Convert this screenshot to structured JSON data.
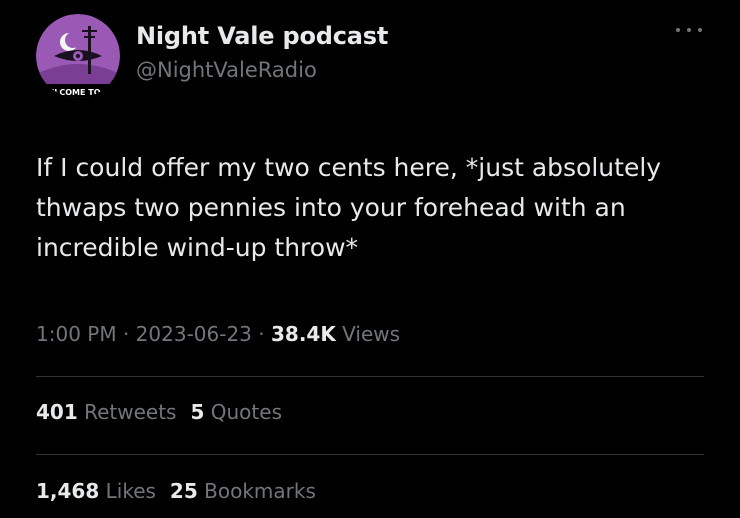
{
  "author": {
    "name": "Night Vale podcast",
    "handle": "@NightValeRadio",
    "avatar_text": "WELCOME TO NIGHT VALE",
    "avatar_colors": {
      "bg": "#9b59b6",
      "ring": "#2b1b33",
      "ink": "#1a1020"
    }
  },
  "tweet": {
    "text": "If I could offer my two cents here, *just absolutely thwaps two pennies into your forehead with an incredible wind-up throw*"
  },
  "meta": {
    "time": "1:00 PM",
    "sep1": " · ",
    "date": "2023-06-23",
    "sep2": " · ",
    "views_count": "38.4K",
    "views_label": " Views"
  },
  "stats_row1": {
    "retweets_count": "401",
    "retweets_label": " Retweets",
    "quotes_count": "5",
    "quotes_label": " Quotes"
  },
  "stats_row2": {
    "likes_count": "1,468",
    "likes_label": " Likes",
    "bookmarks_count": "25",
    "bookmarks_label": " Bookmarks"
  },
  "colors": {
    "background": "#000000",
    "text": "#e7e9ea",
    "muted": "#71767b",
    "divider": "#2f3336"
  }
}
